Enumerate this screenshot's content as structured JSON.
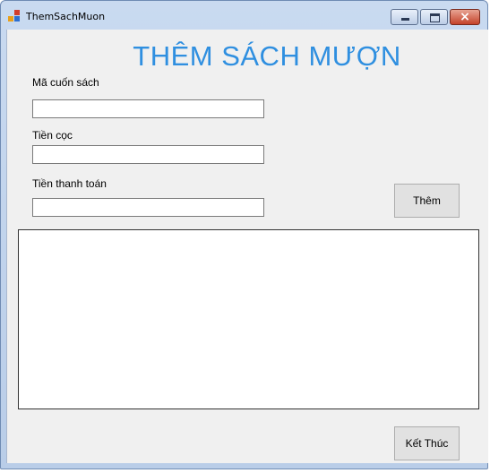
{
  "window": {
    "title": "ThemSachMuon",
    "close_glyph": "×"
  },
  "form": {
    "heading": "THÊM SÁCH MƯỢN",
    "fields": [
      {
        "label": "Mã cuốn sách",
        "value": ""
      },
      {
        "label": "Tiền cọc",
        "value": ""
      },
      {
        "label": "Tiền thanh toán",
        "value": ""
      }
    ],
    "add_button": "Thêm",
    "exit_button": "Kết Thúc"
  },
  "icons": [
    "app-icon",
    "minimize-icon",
    "maximize-icon",
    "close-icon"
  ],
  "colors": {
    "heading": "#2f8fe0",
    "client_bg": "#f0f0f0"
  }
}
